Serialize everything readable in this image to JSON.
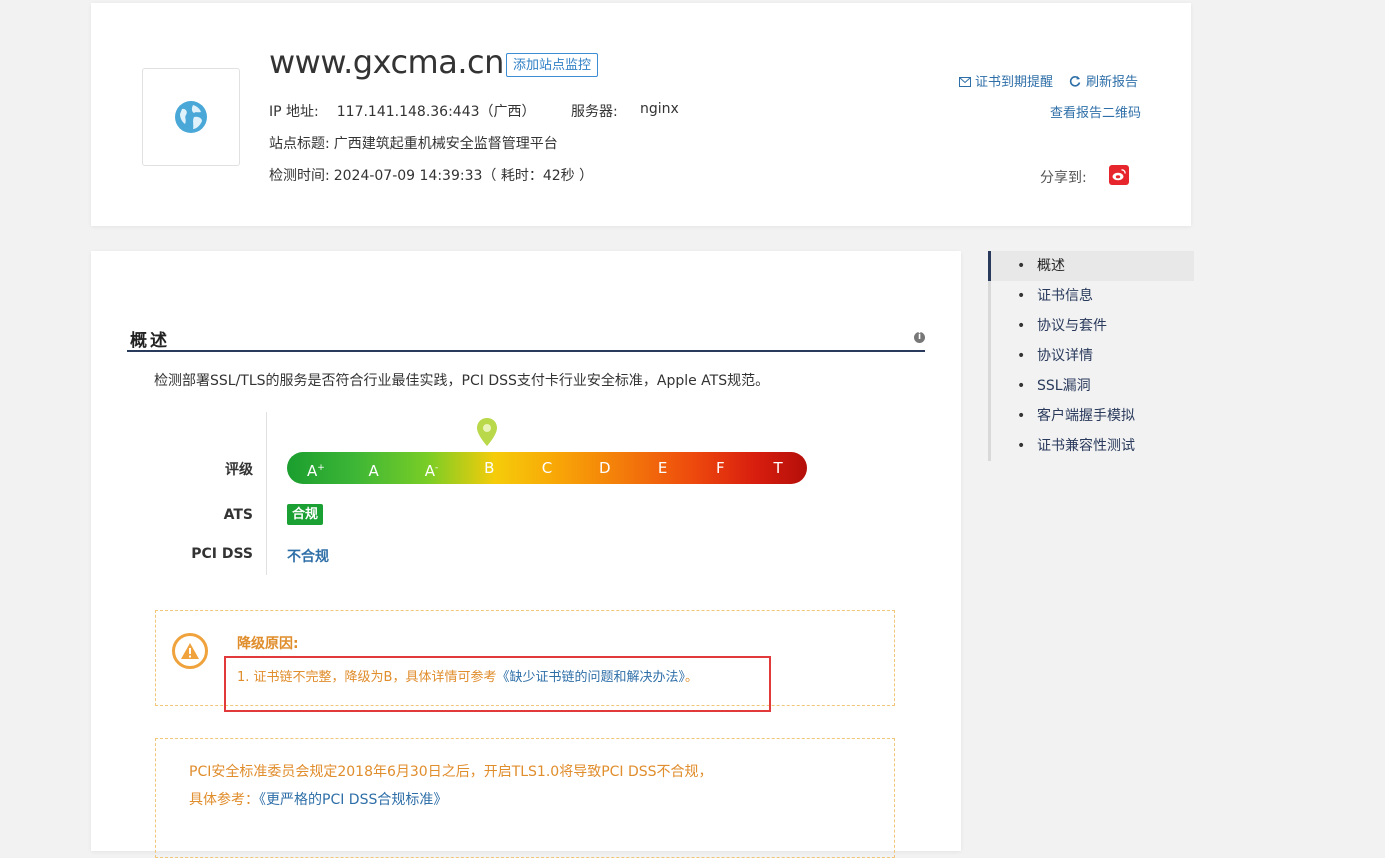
{
  "header": {
    "domain": "www.gxcma.cn",
    "monitor_button": "添加站点监控",
    "ip_label": "IP 地址:",
    "ip_value": "117.141.148.36:443（广西）",
    "server_label": "服务器:",
    "server_value": "nginx",
    "title_label": "站点标题:",
    "title_value": "广西建筑起重机械安全监督管理平台",
    "time_label": "检测时间:",
    "time_value": "2024-07-09 14:39:33（ 耗时：42秒 ）",
    "cert_remind": "证书到期提醒",
    "refresh": "刷新报告",
    "qr_link": "查看报告二维码",
    "share_label": "分享到:"
  },
  "overview": {
    "title": "概述",
    "description": "检测部署SSL/TLS的服务是否符合行业最佳实践，PCI DSS支付卡行业安全标准，Apple ATS规范。",
    "grade_label": "评级",
    "grades": [
      "A",
      "A",
      "A",
      "B",
      "C",
      "D",
      "E",
      "F",
      "T"
    ],
    "grade_marks": [
      "+",
      "",
      "-",
      "",
      "",
      "",
      "",
      "",
      ""
    ],
    "current_grade": "B",
    "ats_label": "ATS",
    "ats_value": "合规",
    "pci_label": "PCI DSS",
    "pci_value": "不合规",
    "reason_title": "降级原因:",
    "reason_text_prefix": "1. 证书链不完整，降级为B，具体详情可参考",
    "reason_link": "《缺少证书链的问题和解决办法》",
    "reason_text_suffix": "。",
    "pci_note_line1": "PCI安全标准委员会规定2018年6月30日之后，开启TLS1.0将导致PCI DSS不合规，",
    "pci_note_prefix": "具体参考：",
    "pci_note_link": "《更严格的PCI DSS合规标准》"
  },
  "nav": {
    "items": [
      "概述",
      "证书信息",
      "协议与套件",
      "协议详情",
      "SSL漏洞",
      "客户端握手模拟",
      "证书兼容性测试"
    ]
  },
  "colors": {
    "accent": "#2f6fa8",
    "warning": "#e08d2c",
    "ok": "#1aa033",
    "highlight": "#e23a3a"
  }
}
